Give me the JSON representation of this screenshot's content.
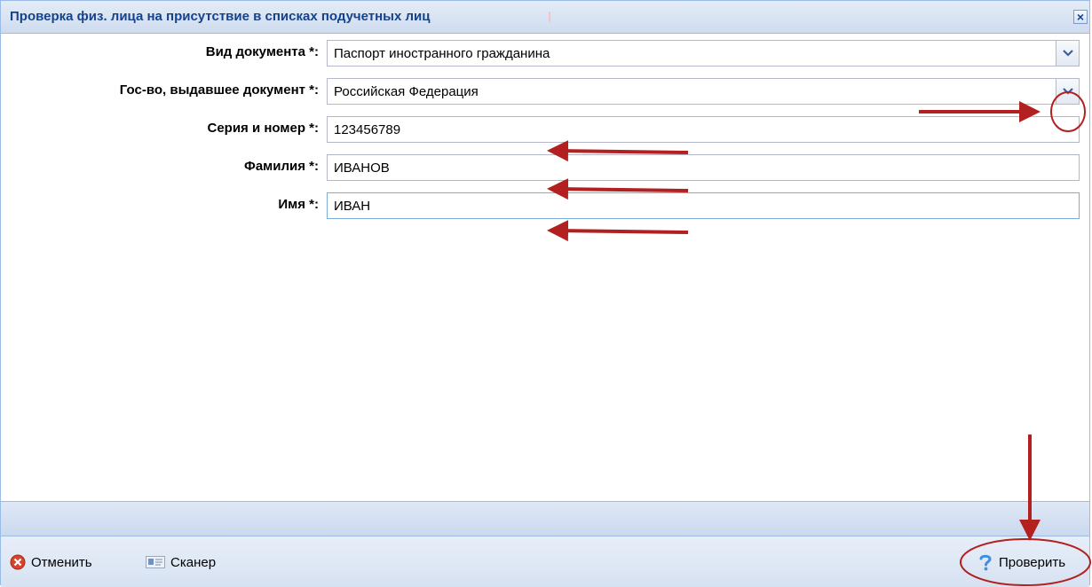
{
  "window": {
    "title": "Проверка физ. лица на присутствие в списках подучетных лиц"
  },
  "form": {
    "doc_type": {
      "label": "Вид документа *:",
      "value": "Паспорт иностранного гражданина"
    },
    "issuing_state": {
      "label": "Гос-во, выдавшее документ *:",
      "value": "Российская Федерация"
    },
    "series_number": {
      "label": "Серия и номер *:",
      "value": "123456789"
    },
    "last_name": {
      "label": "Фамилия *:",
      "value": "ИВАНОВ"
    },
    "first_name": {
      "label": "Имя *:",
      "value": "ИВАН"
    }
  },
  "footer": {
    "cancel_label": "Отменить",
    "scanner_label": "Сканер",
    "check_label": "Проверить"
  },
  "colors": {
    "annotation": "#b32020",
    "title_text": "#15428b",
    "border": "#99bbe8"
  },
  "icons": [
    "close-icon",
    "chevron-down-icon",
    "cancel-icon",
    "scanner-icon",
    "help-icon"
  ]
}
